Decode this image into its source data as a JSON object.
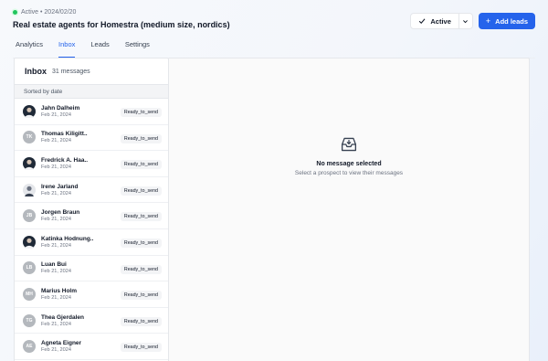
{
  "header": {
    "status_text": "Active • 2024/02/20",
    "title": "Real estate agents for Homestra (medium size, nordics)",
    "status_select": "Active",
    "add_leads": "Add leads"
  },
  "tabs": [
    {
      "label": "Analytics"
    },
    {
      "label": "Inbox"
    },
    {
      "label": "Leads"
    },
    {
      "label": "Settings"
    }
  ],
  "inbox": {
    "title": "Inbox",
    "count": "31 messages",
    "sort_label": "Sorted by date",
    "items": [
      {
        "name": "Jahn Dalheim",
        "date": "Feb 21, 2024",
        "status": "Ready_to_send",
        "avatar": "photo",
        "initials": ""
      },
      {
        "name": "Thomas Kiligitt..",
        "date": "Feb 21, 2024",
        "status": "Ready_to_send",
        "avatar": "initials",
        "initials": "TK"
      },
      {
        "name": "Fredrick A. Haa..",
        "date": "Feb 21, 2024",
        "status": "Ready_to_send",
        "avatar": "photo",
        "initials": ""
      },
      {
        "name": "Irene Jarland",
        "date": "Feb 21, 2024",
        "status": "Ready_to_send",
        "avatar": "photo-light",
        "initials": ""
      },
      {
        "name": "Jorgen Braun",
        "date": "Feb 21, 2024",
        "status": "Ready_to_send",
        "avatar": "initials",
        "initials": "JB"
      },
      {
        "name": "Katinka Hodnung..",
        "date": "Feb 21, 2024",
        "status": "Ready_to_send",
        "avatar": "photo",
        "initials": ""
      },
      {
        "name": "Luan Bui",
        "date": "Feb 21, 2024",
        "status": "Ready_to_send",
        "avatar": "initials",
        "initials": "LB"
      },
      {
        "name": "Marius Holm",
        "date": "Feb 21, 2024",
        "status": "Ready_to_send",
        "avatar": "initials",
        "initials": "MH"
      },
      {
        "name": "Thea Gjerdalen",
        "date": "Feb 21, 2024",
        "status": "Ready_to_send",
        "avatar": "initials",
        "initials": "TG"
      },
      {
        "name": "Agneta Eigner",
        "date": "Feb 21, 2024",
        "status": "Ready_to_send",
        "avatar": "initials",
        "initials": "AE"
      }
    ]
  },
  "empty_state": {
    "icon": "inbox-tray-icon",
    "title": "No message selected",
    "subtitle": "Select a prospect to view their messages"
  },
  "colors": {
    "accent": "#2563eb",
    "active_dot": "#22c55e"
  }
}
